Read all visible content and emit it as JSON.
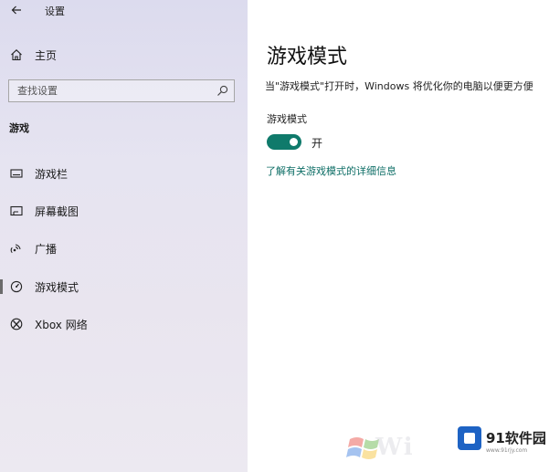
{
  "window": {
    "title": "设置",
    "back_icon": "arrow-left-icon"
  },
  "sidebar": {
    "home_label": "主页",
    "home_icon": "home-icon",
    "search_placeholder": "查找设置",
    "search_icon": "search-icon",
    "section_title": "游戏",
    "items": [
      {
        "label": "游戏栏",
        "icon": "game-bar-icon",
        "active": false
      },
      {
        "label": "屏幕截图",
        "icon": "screenshot-icon",
        "active": false
      },
      {
        "label": "广播",
        "icon": "broadcast-icon",
        "active": false
      },
      {
        "label": "游戏模式",
        "icon": "game-mode-icon",
        "active": true
      },
      {
        "label": "Xbox 网络",
        "icon": "xbox-icon",
        "active": false
      }
    ]
  },
  "main": {
    "title": "游戏模式",
    "description": "当\"游戏模式\"打开时，Windows 将优化你的电脑以便更方便",
    "setting_label": "游戏模式",
    "toggle_on": true,
    "toggle_state_label": "开",
    "link_text": "了解有关游戏模式的详细信息"
  },
  "watermark": {
    "brand": "91软件园",
    "partial_text": "Wi",
    "url": "www.91rjy.com"
  },
  "colors": {
    "accent": "#0f7a6b",
    "link": "#0e6e66",
    "sidebar_bg": "#e4e2f0"
  }
}
